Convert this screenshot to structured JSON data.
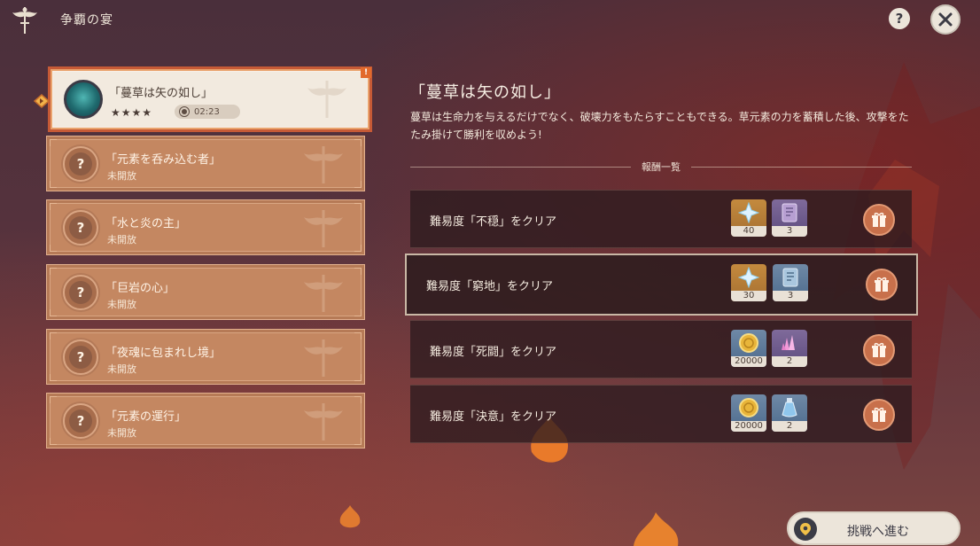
{
  "header": {
    "title": "争覇の宴"
  },
  "challenges": [
    {
      "name": "「蔓草は矢の如し」",
      "stars": "★★★★",
      "timer": "02:23",
      "selected": true
    },
    {
      "name": "「元素を呑み込む者」",
      "status": "未開放",
      "locked_glyph": "?"
    },
    {
      "name": "「水と炎の主」",
      "status": "未開放",
      "locked_glyph": "?"
    },
    {
      "name": "「巨岩の心」",
      "status": "未開放",
      "locked_glyph": "?"
    },
    {
      "name": "「夜魂に包まれし境」",
      "status": "未開放",
      "locked_glyph": "?"
    },
    {
      "name": "「元素の運行」",
      "status": "未開放",
      "locked_glyph": "?"
    }
  ],
  "selected_badge": "!",
  "detail": {
    "title": "「蔓草は矢の如し」",
    "description": "蔓草は生命力を与えるだけでなく、破壊力をもたらすこともできる。草元素の力を蓄積した後、攻撃をたたみ掛けて勝利を収めよう!"
  },
  "rewards": {
    "header": "報酬一覧",
    "rows": [
      {
        "condition": "難易度「不穏」をクリア",
        "items": [
          {
            "icon": "primogem-icon",
            "count": "40"
          },
          {
            "icon": "talent-book-icon",
            "count": "3"
          }
        ]
      },
      {
        "condition": "難易度「窮地」をクリア",
        "items": [
          {
            "icon": "primogem-icon",
            "count": "30"
          },
          {
            "icon": "talent-book-icon",
            "count": "3"
          }
        ],
        "highlighted": true
      },
      {
        "condition": "難易度「死闘」をクリア",
        "items": [
          {
            "icon": "mora-icon",
            "count": "20000"
          },
          {
            "icon": "crystal-icon",
            "count": "2"
          }
        ]
      },
      {
        "condition": "難易度「決意」をクリア",
        "items": [
          {
            "icon": "mora-icon",
            "count": "20000"
          },
          {
            "icon": "potion-icon",
            "count": "2"
          }
        ]
      }
    ]
  },
  "help_glyph": "?",
  "proceed_button": {
    "label": "挑戦へ進む"
  },
  "colors": {
    "accent_orange": "#c8704b",
    "selected_border": "#c65a36",
    "list_item": "#c48761"
  }
}
